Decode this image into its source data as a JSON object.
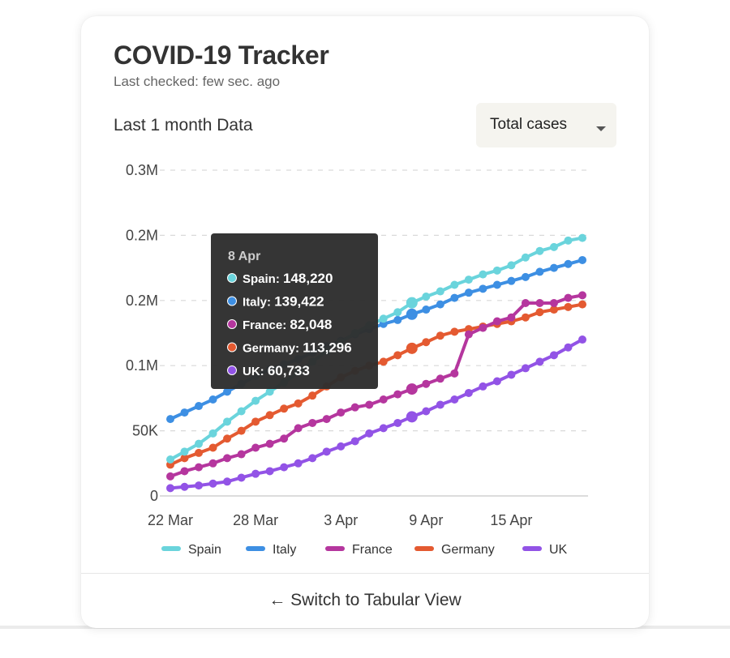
{
  "card": {
    "title": "COVID-19 Tracker",
    "last_checked": "Last checked: few sec. ago",
    "section_label": "Last 1 month Data",
    "metric_select": {
      "selected": "Total cases"
    },
    "switch_button": "← Switch to Tabular View"
  },
  "chart_data": {
    "type": "line",
    "y_tick_labels": [
      "0",
      "50K",
      "0.1M",
      "0.2M",
      "0.2M",
      "0.3M"
    ],
    "y_ticks": [
      0,
      50000,
      100000,
      150000,
      200000,
      250000
    ],
    "ylim": [
      0,
      250000
    ],
    "x_tick_labels": [
      {
        "label": "22 Mar",
        "index": 0
      },
      {
        "label": "28 Mar",
        "index": 6
      },
      {
        "label": "3 Apr",
        "index": 12
      },
      {
        "label": "9 Apr",
        "index": 18
      },
      {
        "label": "15 Apr",
        "index": 24
      }
    ],
    "categories": [
      "22 Mar",
      "23 Mar",
      "24 Mar",
      "25 Mar",
      "26 Mar",
      "27 Mar",
      "28 Mar",
      "29 Mar",
      "30 Mar",
      "31 Mar",
      "1 Apr",
      "2 Apr",
      "3 Apr",
      "4 Apr",
      "5 Apr",
      "6 Apr",
      "7 Apr",
      "8 Apr",
      "9 Apr",
      "10 Apr",
      "11 Apr",
      "12 Apr",
      "13 Apr",
      "14 Apr",
      "15 Apr",
      "16 Apr",
      "17 Apr",
      "18 Apr",
      "19 Apr",
      "20 Apr"
    ],
    "series": [
      {
        "name": "Spain",
        "color": "#6ad4dc",
        "values": [
          28000,
          34000,
          40000,
          48000,
          57000,
          65000,
          73000,
          80000,
          87000,
          95000,
          103000,
          111000,
          118000,
          125000,
          131000,
          136000,
          141000,
          148220,
          153000,
          157000,
          162000,
          166000,
          170000,
          173000,
          177000,
          183000,
          188000,
          191000,
          196000,
          198000
        ]
      },
      {
        "name": "Italy",
        "color": "#3d8fe3",
        "values": [
          59000,
          64000,
          69000,
          74000,
          80000,
          86000,
          92000,
          97000,
          101000,
          105000,
          110000,
          115000,
          119000,
          124000,
          128000,
          132000,
          135000,
          139422,
          143000,
          147000,
          152000,
          156000,
          159000,
          162000,
          165000,
          168000,
          172000,
          175000,
          178000,
          181000
        ]
      },
      {
        "name": "France",
        "color": "#b5369e",
        "values": [
          15000,
          19000,
          22000,
          25000,
          29000,
          32000,
          37000,
          40000,
          44000,
          52000,
          56000,
          59000,
          64000,
          68000,
          70000,
          74000,
          78000,
          82048,
          86000,
          90000,
          94000,
          124000,
          129000,
          134000,
          137000,
          148000,
          148000,
          148000,
          152000,
          154000
        ]
      },
      {
        "name": "Germany",
        "color": "#e45a31",
        "values": [
          24000,
          29000,
          33000,
          37000,
          44000,
          50000,
          57000,
          62000,
          67000,
          71000,
          77000,
          84000,
          91000,
          96000,
          100000,
          103000,
          108000,
          113296,
          118000,
          123000,
          126000,
          128000,
          130000,
          132000,
          134000,
          137000,
          141000,
          143000,
          145000,
          147000
        ]
      },
      {
        "name": "UK",
        "color": "#9253e6",
        "values": [
          6000,
          7000,
          8000,
          9500,
          11000,
          14000,
          17000,
          19000,
          22000,
          25000,
          29000,
          34000,
          38000,
          42000,
          48000,
          52000,
          56000,
          60733,
          65000,
          70000,
          74000,
          79000,
          84000,
          88000,
          93000,
          98000,
          103000,
          108000,
          114000,
          120000
        ]
      }
    ],
    "legend_position": "bottom",
    "grid": "dashed horizontal",
    "tooltip": {
      "title": "8 Apr",
      "index": 17,
      "rows": [
        {
          "name": "Spain:",
          "value": "148,220",
          "color": "#6ad4dc"
        },
        {
          "name": "Italy:",
          "value": "139,422",
          "color": "#3d8fe3"
        },
        {
          "name": "France:",
          "value": "82,048",
          "color": "#b5369e"
        },
        {
          "name": "Germany:",
          "value": "113,296",
          "color": "#e45a31"
        },
        {
          "name": "UK:",
          "value": "60,733",
          "color": "#9253e6"
        }
      ]
    }
  }
}
